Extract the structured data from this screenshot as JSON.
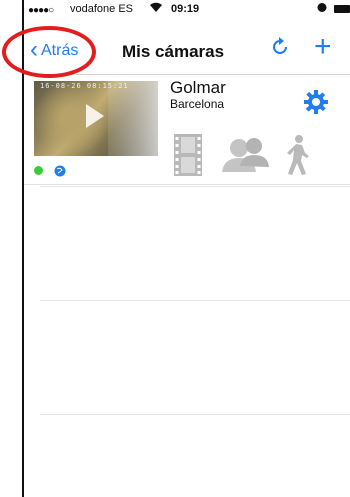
{
  "status_bar": {
    "signal": "●●●●○",
    "carrier": "vodafone ES",
    "wifi_icon": "wifi-icon",
    "time": "09:19",
    "alarm_icon": "alarm-icon",
    "battery_icon": "battery-icon"
  },
  "nav": {
    "back_label": "Atrás",
    "title": "Mis cámaras",
    "refresh_icon": "refresh-icon",
    "add_label": "+"
  },
  "cameras": [
    {
      "name": "Golmar",
      "city": "Barcelona",
      "thumbnail_timestamp": "16-08-26 08:15:21",
      "status_color": "#3acb35",
      "actions": [
        "film-icon",
        "users-icon",
        "walking-person-icon"
      ]
    }
  ],
  "colors": {
    "accent": "#1f7ef0",
    "highlight": "#e21d1d",
    "icon_gray": "#b9b9b9"
  }
}
